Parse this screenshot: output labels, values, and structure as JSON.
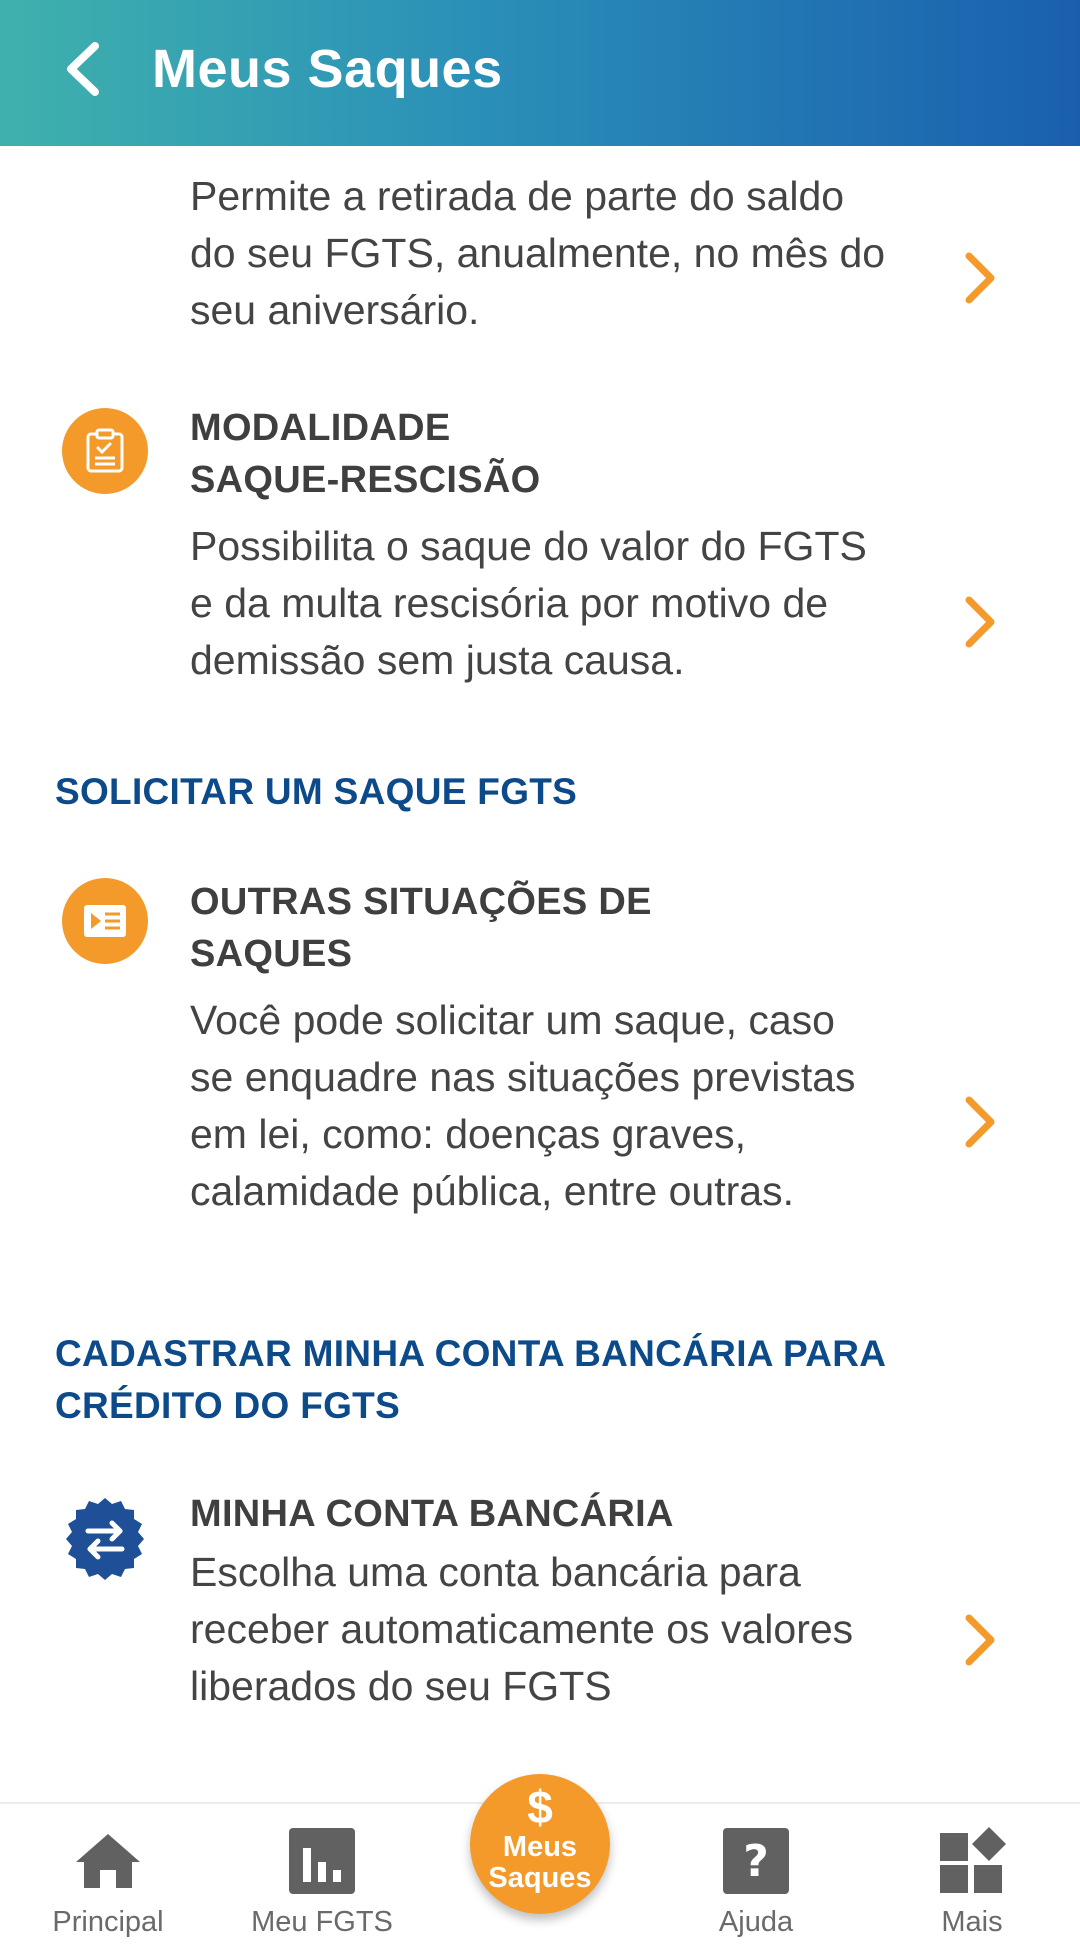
{
  "header": {
    "title": "Meus Saques"
  },
  "items": [
    {
      "title_line1": "",
      "title_line2": "",
      "desc_lines": [
        "Permite a retirada de parte do saldo",
        "do seu FGTS, anualmente, no mês do",
        "seu aniversário."
      ]
    },
    {
      "title_line1": "MODALIDADE",
      "title_line2": "SAQUE-RESCISÃO",
      "desc_lines": [
        "Possibilita o saque do valor do FGTS",
        "e da multa rescisória por motivo de",
        "demissão sem justa causa."
      ]
    },
    {
      "title_line1": "OUTRAS SITUAÇÕES DE",
      "title_line2": "SAQUES",
      "desc_lines": [
        "Você pode solicitar um saque, caso",
        "se enquadre nas situações previstas",
        "em lei, como: doenças graves,",
        "calamidade pública, entre outras."
      ]
    },
    {
      "title_line1": "MINHA CONTA BANCÁRIA",
      "title_line2": "",
      "desc_lines": [
        "Escolha uma conta bancária para",
        "receber automaticamente os valores",
        "liberados do seu FGTS"
      ]
    }
  ],
  "sections": {
    "solicitar": "SOLICITAR UM SAQUE FGTS",
    "cadastrar_line1": "CADASTRAR MINHA CONTA BANCÁRIA PARA",
    "cadastrar_line2": "CRÉDITO DO FGTS"
  },
  "bottom_nav": {
    "principal": "Principal",
    "meu_fgts": "Meu FGTS",
    "fab_symbol": "$",
    "fab_line1": "Meus",
    "fab_line2": "Saques",
    "ajuda": "Ajuda",
    "mais": "Mais"
  },
  "colors": {
    "accent_orange": "#f39a2b",
    "section_blue": "#0d4a8a",
    "icon_blue": "#1f4f96"
  },
  "icons": {
    "back": "chevron-left-icon",
    "clipboard": "clipboard-check-icon",
    "document": "document-play-icon",
    "transfer": "transfer-arrows-icon",
    "home": "home-icon",
    "bar_chart": "bar-chart-icon",
    "help": "question-icon",
    "more": "grid-more-icon"
  }
}
